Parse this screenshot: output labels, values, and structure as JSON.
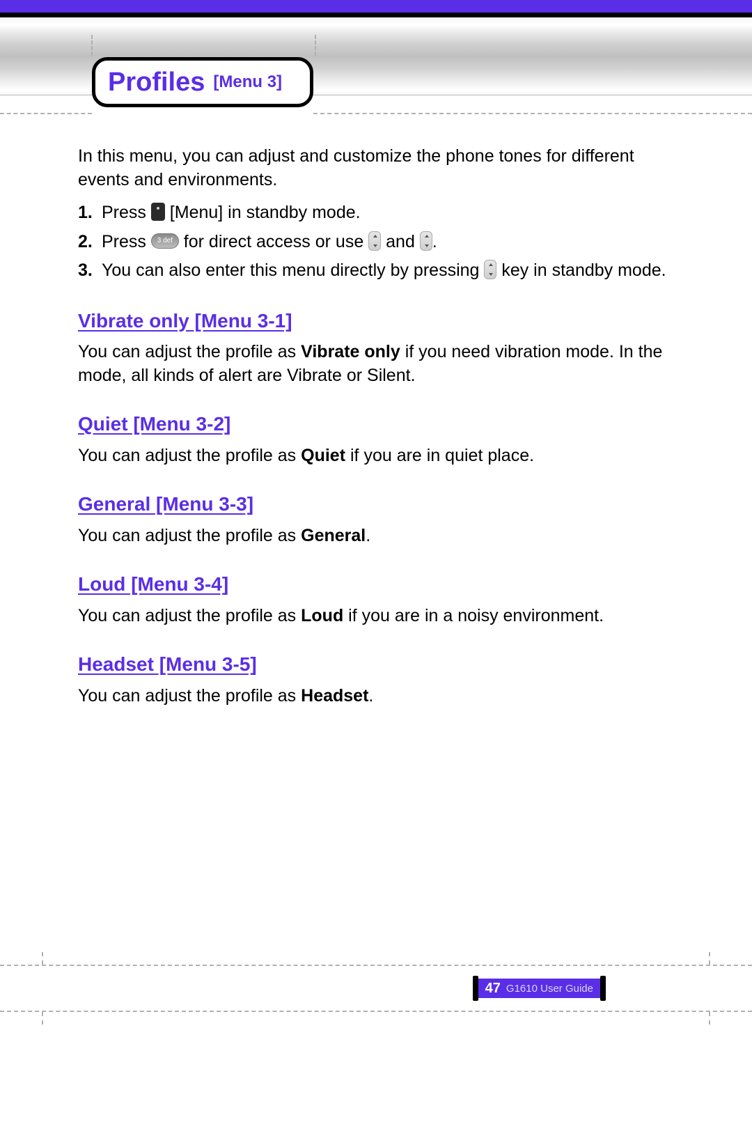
{
  "header": {
    "title_main": "Profiles",
    "title_sub": "[Menu 3]"
  },
  "intro": "In this menu, you can adjust and customize the phone tones for different events and environments.",
  "steps": [
    {
      "num": "1.",
      "pre": "Press ",
      "icon": "menu",
      "post": " [Menu] in standby mode."
    },
    {
      "num": "2.",
      "pre": "Press",
      "icon": "pill",
      "mid": " for direct access or use ",
      "icon2": "nav",
      "mid2": " and ",
      "icon3": "nav",
      "post": "."
    },
    {
      "num": "3.",
      "pre": "You can also enter this menu directly by pressing ",
      "icon": "nav",
      "post": " key in standby mode."
    }
  ],
  "sections": [
    {
      "heading": "Vibrate only [Menu 3-1]",
      "pre": "You can adjust the profile as ",
      "bold": "Vibrate only",
      "post": " if you need vibration mode. In the mode, all kinds of alert are Vibrate or Silent."
    },
    {
      "heading": "Quiet [Menu 3-2]",
      "pre": "You can adjust the profile as ",
      "bold": "Quiet",
      "post": " if you are in quiet place."
    },
    {
      "heading": "General [Menu 3-3]",
      "pre": "You can adjust the profile as ",
      "bold": "General",
      "post": "."
    },
    {
      "heading": "Loud [Menu 3-4]",
      "pre": "You can adjust the profile as ",
      "bold": "Loud",
      "post": " if you are in a noisy environment."
    },
    {
      "heading": "Headset [Menu 3-5]",
      "pre": "You can adjust the profile as ",
      "bold": "Headset",
      "post": "."
    }
  ],
  "footer": {
    "page_number": "47",
    "guide_label": "G1610 User Guide"
  }
}
